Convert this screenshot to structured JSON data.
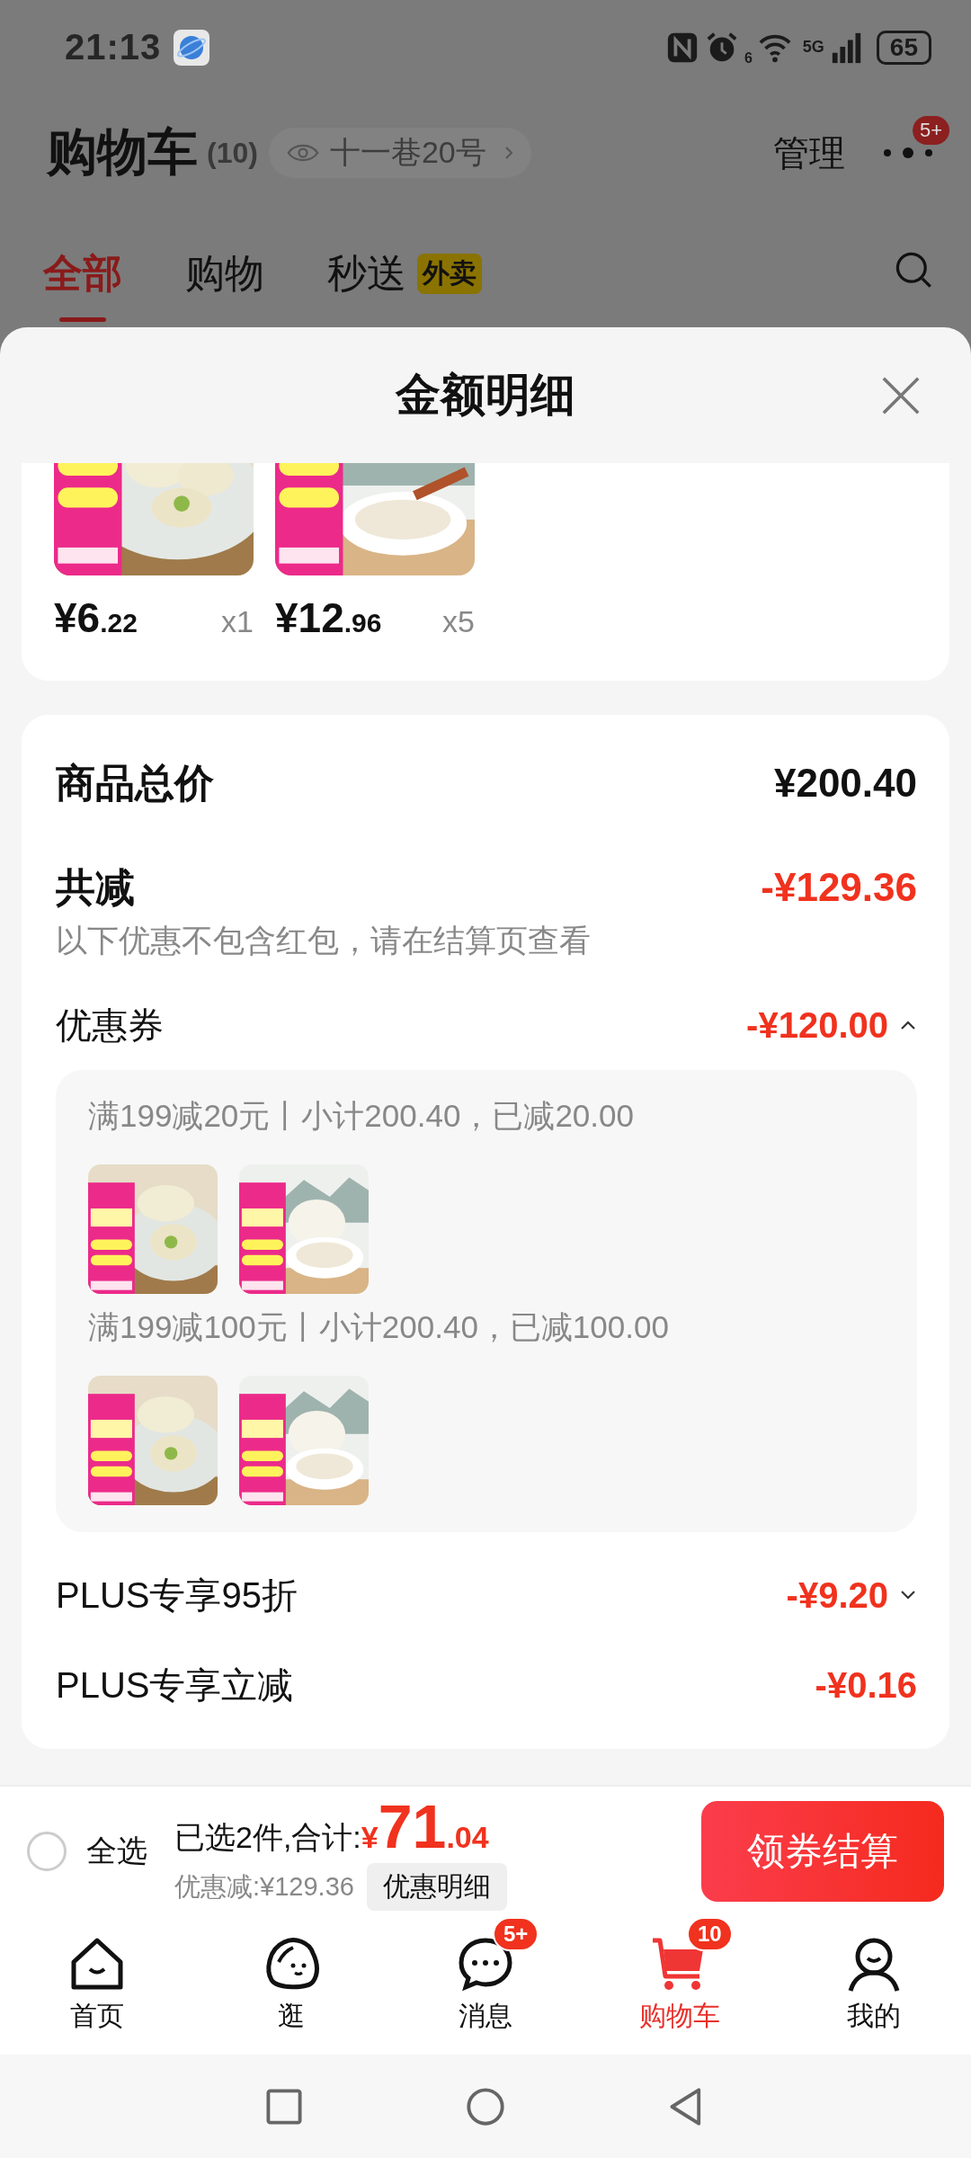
{
  "status_bar": {
    "time": "21:13",
    "wifi_label": "6",
    "network": "5G",
    "battery": "65"
  },
  "header": {
    "title": "购物车",
    "count": "(10)",
    "address": "十一巷20号",
    "manage": "管理",
    "more_badge": "5+"
  },
  "tabs": [
    {
      "label": "全部",
      "selected": true
    },
    {
      "label": "购物",
      "selected": false
    },
    {
      "label": "秒送",
      "tag": "外卖",
      "selected": false
    }
  ],
  "sheet": {
    "title": "金额明细",
    "products": [
      {
        "kind": "picture",
        "price_main": "¥6",
        "price_cents": ".22",
        "qty": "x1"
      },
      {
        "kind": "picture",
        "price_main": "¥12",
        "price_cents": ".96",
        "qty": "x5"
      }
    ],
    "total_label": "商品总价",
    "total_value": "¥200.40",
    "reduce_label": "共减",
    "reduce_value": "-¥129.36",
    "note": "以下优惠不包含红包，请在结算页查看",
    "rows": [
      {
        "kind": "expandable",
        "label": "优惠券",
        "value": "-¥120.00",
        "expanded": true,
        "groups": [
          {
            "text": "满199减20元丨小计200.40，已减20.00"
          },
          {
            "text": "满199减100元丨小计200.40，已减100.00"
          }
        ]
      },
      {
        "kind": "expandable",
        "label": "PLUS专享95折",
        "value": "-¥9.20",
        "expanded": false
      },
      {
        "kind": "plain",
        "label": "PLUS专享立减",
        "value": "-¥0.16"
      }
    ]
  },
  "checkout_bar": {
    "select_all": {
      "label": "全选",
      "checked": false
    },
    "summary": "已选2件,合计:",
    "currency": "¥",
    "amount_main": "71",
    "amount_cents": ".04",
    "discount": "优惠减:¥129.36",
    "detail_button": "优惠明细",
    "checkout_button": "领券结算"
  },
  "bottom_nav": [
    {
      "label": "首页",
      "selected": false
    },
    {
      "label": "逛",
      "selected": false
    },
    {
      "label": "消息",
      "badge": "5+",
      "selected": false
    },
    {
      "label": "购物车",
      "badge": "10",
      "selected": true
    },
    {
      "label": "我的",
      "selected": false
    }
  ]
}
